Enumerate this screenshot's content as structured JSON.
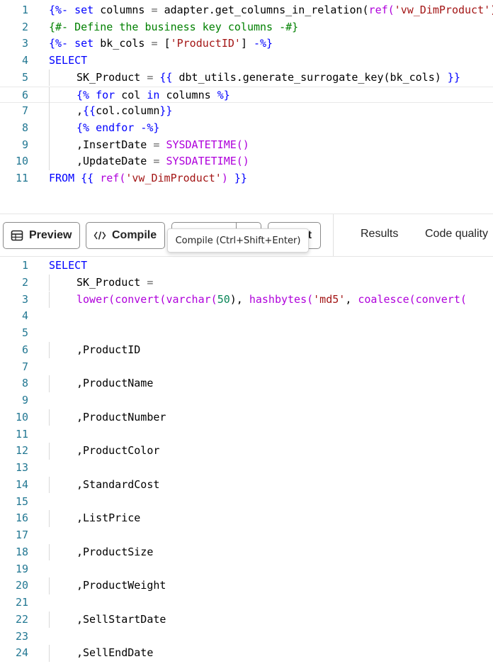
{
  "source_editor": {
    "line_numbers": [
      "1",
      "2",
      "3",
      "4",
      "5",
      "6",
      "7",
      "8",
      "9",
      "10",
      "11"
    ],
    "lines": [
      {
        "indent": 0,
        "tokens": [
          {
            "t": "{%-",
            "c": "t-dbt"
          },
          {
            "t": " set ",
            "c": "t-kw"
          },
          {
            "t": "columns",
            "c": "t-id"
          },
          {
            "t": " = ",
            "c": "t-op"
          },
          {
            "t": "adapter.get_columns_in_relation(",
            "c": "t-id"
          },
          {
            "t": "ref(",
            "c": "t-fn"
          },
          {
            "t": "'vw_DimProduct')",
            "c": "t-str"
          }
        ]
      },
      {
        "indent": 0,
        "tokens": [
          {
            "t": "{#- Define the business key columns -#}",
            "c": "t-cmt"
          }
        ]
      },
      {
        "indent": 0,
        "tokens": [
          {
            "t": "{%-",
            "c": "t-dbt"
          },
          {
            "t": " set ",
            "c": "t-kw"
          },
          {
            "t": "bk_cols",
            "c": "t-id"
          },
          {
            "t": " = ",
            "c": "t-op"
          },
          {
            "t": "[",
            "c": "t-id"
          },
          {
            "t": "'ProductID'",
            "c": "t-str"
          },
          {
            "t": "]",
            "c": "t-id"
          },
          {
            "t": " -%}",
            "c": "t-dbt"
          }
        ]
      },
      {
        "indent": 0,
        "tokens": [
          {
            "t": "SELECT",
            "c": "t-kw"
          }
        ]
      },
      {
        "indent": 1,
        "tokens": [
          {
            "t": "SK_Product",
            "c": "t-id"
          },
          {
            "t": " = ",
            "c": "t-op"
          },
          {
            "t": "{{",
            "c": "t-dbt"
          },
          {
            "t": " dbt_utils.generate_surrogate_key(bk_cols) ",
            "c": "t-id"
          },
          {
            "t": "}}",
            "c": "t-dbt"
          }
        ]
      },
      {
        "indent": 1,
        "current": true,
        "tokens": [
          {
            "t": "{%",
            "c": "t-dbt"
          },
          {
            "t": " for ",
            "c": "t-kw"
          },
          {
            "t": "col",
            "c": "t-id"
          },
          {
            "t": " in ",
            "c": "t-kw"
          },
          {
            "t": "columns ",
            "c": "t-id"
          },
          {
            "t": "%}",
            "c": "t-dbt"
          }
        ]
      },
      {
        "indent": 1,
        "tokens": [
          {
            "t": ",",
            "c": "t-id"
          },
          {
            "t": "{{",
            "c": "t-dbt"
          },
          {
            "t": "col.column",
            "c": "t-id"
          },
          {
            "t": "}}",
            "c": "t-dbt"
          }
        ]
      },
      {
        "indent": 1,
        "tokens": [
          {
            "t": "{%",
            "c": "t-dbt"
          },
          {
            "t": " endfor ",
            "c": "t-kw"
          },
          {
            "t": "-%}",
            "c": "t-dbt"
          }
        ]
      },
      {
        "indent": 1,
        "tokens": [
          {
            "t": ",InsertDate",
            "c": "t-id"
          },
          {
            "t": " = ",
            "c": "t-op"
          },
          {
            "t": "SYSDATETIME()",
            "c": "t-fn"
          }
        ]
      },
      {
        "indent": 1,
        "tokens": [
          {
            "t": ",UpdateDate",
            "c": "t-id"
          },
          {
            "t": " = ",
            "c": "t-op"
          },
          {
            "t": "SYSDATETIME()",
            "c": "t-fn"
          }
        ]
      },
      {
        "indent": 0,
        "tokens": [
          {
            "t": "FROM ",
            "c": "t-kw"
          },
          {
            "t": "{{",
            "c": "t-dbt"
          },
          {
            "t": " ref(",
            "c": "t-fn"
          },
          {
            "t": "'vw_DimProduct'",
            "c": "t-str"
          },
          {
            "t": ")",
            "c": "t-fn"
          },
          {
            "t": " }}",
            "c": "t-dbt"
          }
        ]
      }
    ]
  },
  "toolbar": {
    "preview_label": "Preview",
    "compile_label": "Compile",
    "other_label": "t",
    "results_tab": "Results",
    "code_quality_tab": "Code quality"
  },
  "tooltip": {
    "text": "Compile (Ctrl+Shift+Enter)"
  },
  "compiled_editor": {
    "line_numbers": [
      "1",
      "2",
      "3",
      "4",
      "5",
      "6",
      "7",
      "8",
      "9",
      "10",
      "11",
      "12",
      "13",
      "14",
      "15",
      "16",
      "17",
      "18",
      "19",
      "20",
      "21",
      "22",
      "23",
      "24"
    ],
    "lines": [
      {
        "indent": 0,
        "tokens": [
          {
            "t": "SELECT",
            "c": "t-kw"
          }
        ]
      },
      {
        "indent": 1,
        "tokens": [
          {
            "t": "SK_Product",
            "c": "t-id"
          },
          {
            "t": " =",
            "c": "t-op"
          }
        ]
      },
      {
        "indent": 1,
        "tokens": [
          {
            "t": "lower(",
            "c": "t-fn"
          },
          {
            "t": "convert(",
            "c": "t-fn"
          },
          {
            "t": "varchar(",
            "c": "t-fn"
          },
          {
            "t": "50",
            "c": "t-num"
          },
          {
            "t": "), ",
            "c": "t-id"
          },
          {
            "t": "hashbytes(",
            "c": "t-fn"
          },
          {
            "t": "'md5'",
            "c": "t-str"
          },
          {
            "t": ", ",
            "c": "t-id"
          },
          {
            "t": "coalesce(",
            "c": "t-fn"
          },
          {
            "t": "convert(",
            "c": "t-fn"
          }
        ]
      },
      {
        "indent": 0,
        "tokens": []
      },
      {
        "indent": 0,
        "tokens": []
      },
      {
        "indent": 1,
        "tokens": [
          {
            "t": ",ProductID",
            "c": "t-id"
          }
        ]
      },
      {
        "indent": 0,
        "tokens": []
      },
      {
        "indent": 1,
        "tokens": [
          {
            "t": ",ProductName",
            "c": "t-id"
          }
        ]
      },
      {
        "indent": 0,
        "tokens": []
      },
      {
        "indent": 1,
        "tokens": [
          {
            "t": ",ProductNumber",
            "c": "t-id"
          }
        ]
      },
      {
        "indent": 0,
        "tokens": []
      },
      {
        "indent": 1,
        "tokens": [
          {
            "t": ",ProductColor",
            "c": "t-id"
          }
        ]
      },
      {
        "indent": 0,
        "tokens": []
      },
      {
        "indent": 1,
        "tokens": [
          {
            "t": ",StandardCost",
            "c": "t-id"
          }
        ]
      },
      {
        "indent": 0,
        "tokens": []
      },
      {
        "indent": 1,
        "tokens": [
          {
            "t": ",ListPrice",
            "c": "t-id"
          }
        ]
      },
      {
        "indent": 0,
        "tokens": []
      },
      {
        "indent": 1,
        "tokens": [
          {
            "t": ",ProductSize",
            "c": "t-id"
          }
        ]
      },
      {
        "indent": 0,
        "tokens": []
      },
      {
        "indent": 1,
        "tokens": [
          {
            "t": ",ProductWeight",
            "c": "t-id"
          }
        ]
      },
      {
        "indent": 0,
        "tokens": []
      },
      {
        "indent": 1,
        "tokens": [
          {
            "t": ",SellStartDate",
            "c": "t-id"
          }
        ]
      },
      {
        "indent": 0,
        "tokens": []
      },
      {
        "indent": 1,
        "tokens": [
          {
            "t": ",SellEndDate",
            "c": "t-id"
          }
        ]
      }
    ]
  }
}
